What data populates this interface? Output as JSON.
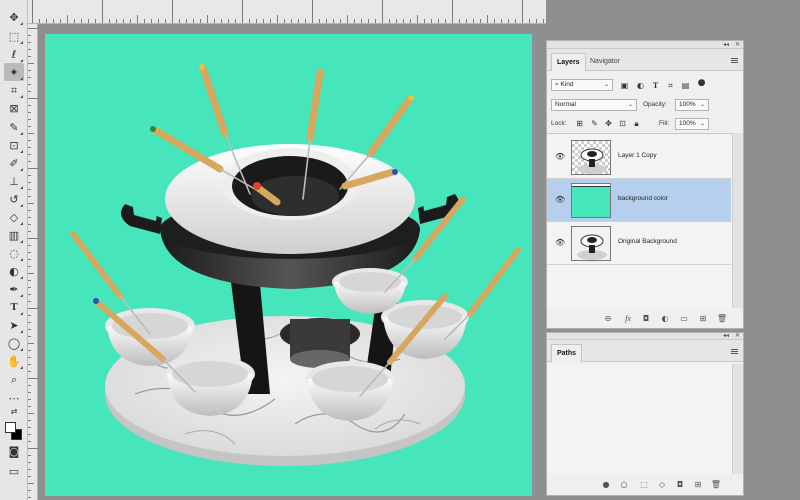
{
  "tools": [
    {
      "name": "move-tool",
      "glyph": "✥"
    },
    {
      "name": "marquee-tool",
      "glyph": "⬚"
    },
    {
      "name": "lasso-tool",
      "glyph": "ℓ"
    },
    {
      "name": "magic-wand-tool",
      "glyph": "✦"
    },
    {
      "name": "crop-tool",
      "glyph": "⌗"
    },
    {
      "name": "frame-tool",
      "glyph": "⊠"
    },
    {
      "name": "eyedropper-tool",
      "glyph": "✎"
    },
    {
      "name": "spot-healing-tool",
      "glyph": "⊡"
    },
    {
      "name": "brush-tool",
      "glyph": "✐"
    },
    {
      "name": "clone-stamp-tool",
      "glyph": "⊥"
    },
    {
      "name": "history-brush-tool",
      "glyph": "↺"
    },
    {
      "name": "eraser-tool",
      "glyph": "◇"
    },
    {
      "name": "gradient-tool",
      "glyph": "▥"
    },
    {
      "name": "blur-tool",
      "glyph": "◌"
    },
    {
      "name": "dodge-tool",
      "glyph": "◐"
    },
    {
      "name": "pen-tool",
      "glyph": "✒"
    },
    {
      "name": "type-tool",
      "glyph": "T"
    },
    {
      "name": "path-selection-tool",
      "glyph": "➤"
    },
    {
      "name": "ellipse-tool",
      "glyph": "◯"
    },
    {
      "name": "hand-tool",
      "glyph": "✋"
    },
    {
      "name": "zoom-tool",
      "glyph": "⌕"
    },
    {
      "name": "more-tools",
      "glyph": "⋯"
    }
  ],
  "swatch": {
    "foreground": "#ffffff",
    "background": "#000000"
  },
  "canvas": {
    "background_color": "#46e5bb"
  },
  "layers_panel": {
    "tabs": [
      "Layers",
      "Navigator"
    ],
    "filter_kind": "Kind",
    "blend_mode": "Normal",
    "opacity_label": "Opacity:",
    "opacity_value": "100%",
    "lock_label": "Lock:",
    "fill_label": "Fill:",
    "fill_value": "100%",
    "layers": [
      {
        "name": "Layer 1 Copy",
        "thumb": "transparent-product",
        "visible": true,
        "selected": false
      },
      {
        "name": "background color",
        "thumb": "solid-color",
        "visible": true,
        "selected": true
      },
      {
        "name": "Original Background",
        "thumb": "photo",
        "visible": true,
        "selected": false
      }
    ],
    "selection_color": "#b5cfec"
  },
  "paths_panel": {
    "tab": "Paths"
  }
}
